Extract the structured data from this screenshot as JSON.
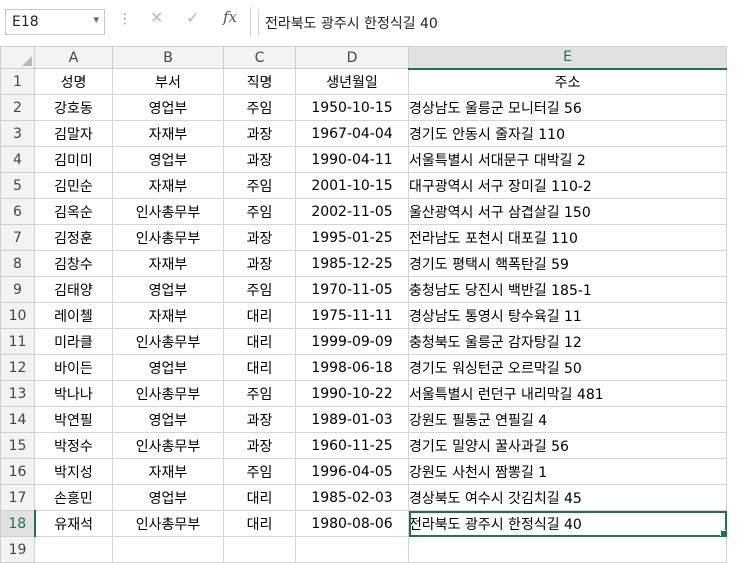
{
  "formula_bar": {
    "name_box": "E18",
    "name_box_arrow": "▾",
    "separator": "⋮",
    "cancel_glyph": "✕",
    "enter_glyph": "✓",
    "fx_label": "fx",
    "content": "전라북도 광주시 한정식길 40"
  },
  "columns": [
    "A",
    "B",
    "C",
    "D",
    "E"
  ],
  "row_numbers": [
    "1",
    "2",
    "3",
    "4",
    "5",
    "6",
    "7",
    "8",
    "9",
    "10",
    "11",
    "12",
    "13",
    "14",
    "15",
    "16",
    "17",
    "18",
    "19"
  ],
  "active_cell": "E18",
  "accent_color": "#217346",
  "table": {
    "headers": [
      "성명",
      "부서",
      "직명",
      "생년월일",
      "주소"
    ],
    "rows": [
      [
        "강호동",
        "영업부",
        "주임",
        "1950-10-15",
        "경상남도 울릉군 모니터길 56"
      ],
      [
        "김말자",
        "자재부",
        "과장",
        "1967-04-04",
        "경기도 안동시 줄자길 110"
      ],
      [
        "김미미",
        "영업부",
        "과장",
        "1990-04-11",
        "서울특별시 서대문구 대박길 2"
      ],
      [
        "김민순",
        "자재부",
        "주임",
        "2001-10-15",
        "대구광역시 서구 장미길 110-2"
      ],
      [
        "김옥순",
        "인사총무부",
        "주임",
        "2002-11-05",
        "울산광역시 서구 삼겹살길 150"
      ],
      [
        "김정훈",
        "인사총무부",
        "과장",
        "1995-01-25",
        "전라남도 포천시 대포길 110"
      ],
      [
        "김창수",
        "자재부",
        "과장",
        "1985-12-25",
        "경기도 평택시 핵폭탄길 59"
      ],
      [
        "김태양",
        "영업부",
        "주임",
        "1970-11-05",
        "충청남도 당진시 백반길 185-1"
      ],
      [
        "레이첼",
        "자재부",
        "대리",
        "1975-11-11",
        "경상남도 통영시 탕수육길 11"
      ],
      [
        "미라클",
        "인사총무부",
        "대리",
        "1999-09-09",
        "충청북도 울릉군 감자탕길 12"
      ],
      [
        "바이든",
        "영업부",
        "대리",
        "1998-06-18",
        "경기도 워싱턴군 오르막길 50"
      ],
      [
        "박나나",
        "인사총무부",
        "주임",
        "1990-10-22",
        "서울특별시 런던구 내리막길 481"
      ],
      [
        "박연필",
        "영업부",
        "과장",
        "1989-01-03",
        "강원도 필통군 연필길 4"
      ],
      [
        "박정수",
        "인사총무부",
        "과장",
        "1960-11-25",
        "경기도 밀양시 꿀사과길 56"
      ],
      [
        "박지성",
        "자재부",
        "주임",
        "1996-04-05",
        "강원도 사천시 짬뽕길 1"
      ],
      [
        "손흥민",
        "영업부",
        "대리",
        "1985-02-03",
        "경상북도 여수시 갓김치길 45"
      ],
      [
        "유재석",
        "인사총무부",
        "대리",
        "1980-08-06",
        "전라북도 광주시 한정식길 40"
      ]
    ]
  }
}
